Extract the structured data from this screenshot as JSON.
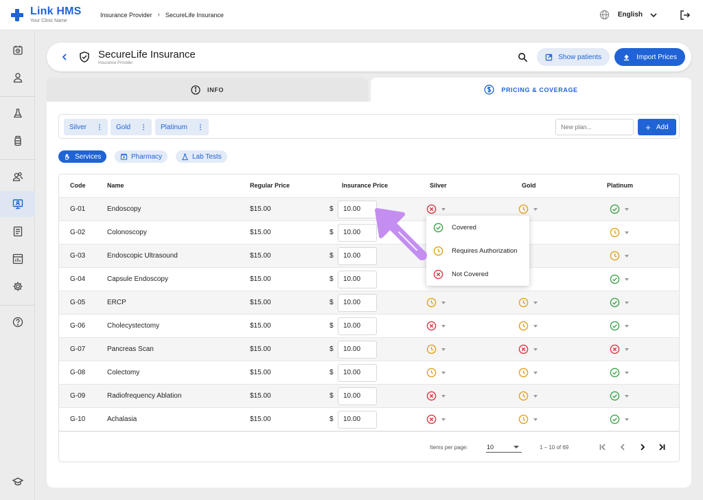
{
  "app": {
    "name": "Link HMS",
    "tagline": "Your Clinic Name"
  },
  "breadcrumb": [
    "Insurance Provider",
    "SecureLife Insurance"
  ],
  "language": "English",
  "header": {
    "title": "SecureLife Insurance",
    "subtitle": "Insurance Provider",
    "show_patients_label": "Show patients",
    "import_prices_label": "Import Prices"
  },
  "tabs": {
    "info": "INFO",
    "pricing": "PRICING & COVERAGE"
  },
  "plans": {
    "chips": [
      "Silver",
      "Gold",
      "Platinum"
    ],
    "new_plan_placeholder": "New plan...",
    "add_label": "Add"
  },
  "categories": [
    "Services",
    "Pharmacy",
    "Lab Tests"
  ],
  "table": {
    "headers": {
      "code": "Code",
      "name": "Name",
      "regular": "Regular Price",
      "insurance": "Insurance Price",
      "silver": "Silver",
      "gold": "Gold",
      "platinum": "Platinum"
    },
    "currency": "$",
    "rows": [
      {
        "code": "G-01",
        "name": "Endoscopy",
        "regular": "$15.00",
        "insurance": "10.00",
        "silver": "not-covered",
        "gold": "requires-authorization",
        "platinum": "covered"
      },
      {
        "code": "G-02",
        "name": "Colonoscopy",
        "regular": "$15.00",
        "insurance": "10.00",
        "silver": "",
        "gold": "",
        "platinum": "requires-authorization"
      },
      {
        "code": "G-03",
        "name": "Endoscopic Ultrasound",
        "regular": "$15.00",
        "insurance": "10.00",
        "silver": "",
        "gold": "",
        "platinum": "requires-authorization"
      },
      {
        "code": "G-04",
        "name": "Capsule Endoscopy",
        "regular": "$15.00",
        "insurance": "10.00",
        "silver": "",
        "gold": "",
        "platinum": "covered"
      },
      {
        "code": "G-05",
        "name": "ERCP",
        "regular": "$15.00",
        "insurance": "10.00",
        "silver": "requires-authorization",
        "gold": "requires-authorization",
        "platinum": "covered"
      },
      {
        "code": "G-06",
        "name": "Cholecystectomy",
        "regular": "$15.00",
        "insurance": "10.00",
        "silver": "not-covered",
        "gold": "requires-authorization",
        "platinum": "covered"
      },
      {
        "code": "G-07",
        "name": "Pancreas Scan",
        "regular": "$15.00",
        "insurance": "10.00",
        "silver": "requires-authorization",
        "gold": "not-covered",
        "platinum": "not-covered"
      },
      {
        "code": "G-08",
        "name": "Colectomy",
        "regular": "$15.00",
        "insurance": "10.00",
        "silver": "requires-authorization",
        "gold": "requires-authorization",
        "platinum": "covered"
      },
      {
        "code": "G-09",
        "name": "Radiofrequency Ablation",
        "regular": "$15.00",
        "insurance": "10.00",
        "silver": "not-covered",
        "gold": "requires-authorization",
        "platinum": "covered"
      },
      {
        "code": "G-10",
        "name": "Achalasia",
        "regular": "$15.00",
        "insurance": "10.00",
        "silver": "not-covered",
        "gold": "requires-authorization",
        "platinum": "covered"
      }
    ]
  },
  "dropdown": {
    "options": [
      "Covered",
      "Requires Authorization",
      "Not Covered"
    ]
  },
  "pagination": {
    "items_per_page_label": "Items per page:",
    "page_size": "10",
    "range": "1 – 10 of 69"
  },
  "colors": {
    "primary": "#1f63d6",
    "covered": "#3ca34a",
    "requires_authorization": "#e3a11b",
    "not_covered": "#d93844",
    "annotation_arrow": "#c38ef0"
  }
}
